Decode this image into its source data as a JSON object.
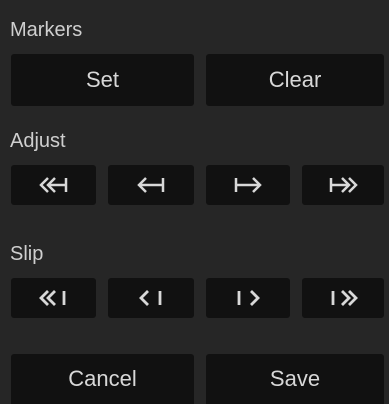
{
  "markers": {
    "title": "Markers",
    "set_label": "Set",
    "clear_label": "Clear"
  },
  "adjust": {
    "title": "Adjust",
    "buttons": [
      {
        "icon": "jump-to-start-icon"
      },
      {
        "icon": "nudge-left-icon"
      },
      {
        "icon": "nudge-right-icon"
      },
      {
        "icon": "jump-to-end-icon"
      }
    ]
  },
  "slip": {
    "title": "Slip",
    "buttons": [
      {
        "icon": "slip-fast-left-icon"
      },
      {
        "icon": "slip-left-icon"
      },
      {
        "icon": "slip-right-icon"
      },
      {
        "icon": "slip-fast-right-icon"
      }
    ]
  },
  "footer": {
    "cancel_label": "Cancel",
    "save_label": "Save"
  },
  "colors": {
    "background": "#262626",
    "button": "#111111",
    "text": "#d8d8d8"
  }
}
